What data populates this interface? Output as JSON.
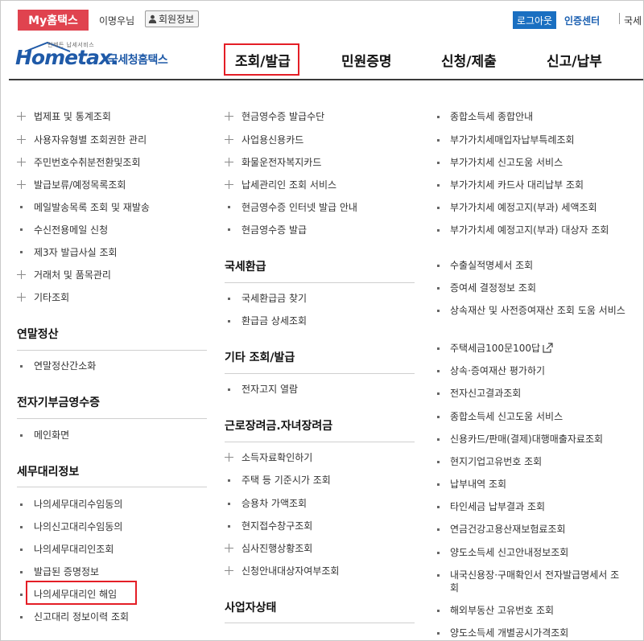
{
  "topbar": {
    "my_hometax": "My홈택스",
    "username": "이명우님",
    "member_info": "회원정보",
    "logout": "로그아웃",
    "cert_center": "인증센터",
    "more": "국세"
  },
  "header": {
    "logo_small": "언제든 납세서비스",
    "logo_main": "Hometax.",
    "logo_korean": "국세청홈택스",
    "nav": [
      "조회/발급",
      "민원증명",
      "신청/제출",
      "신고/납부"
    ],
    "active_nav": "조회/발급"
  },
  "col1": {
    "items": [
      {
        "text": "법제표 및 통계조회",
        "icon": "plus"
      },
      {
        "text": "사용자유형별 조회권한 관리",
        "icon": "plus"
      },
      {
        "text": "주민번호수취분전환및조회",
        "icon": "plus"
      },
      {
        "text": "발급보류/예정목록조회",
        "icon": "plus"
      },
      {
        "text": "메일발송목록 조회 및 재발송",
        "icon": "dot"
      },
      {
        "text": "수신전용메일 신청",
        "icon": "dot"
      },
      {
        "text": "제3자 발급사실 조회",
        "icon": "dot"
      },
      {
        "text": "거래처 및 품목관리",
        "icon": "plus"
      },
      {
        "text": "기타조회",
        "icon": "plus"
      }
    ],
    "sections": [
      {
        "title": "연말정산",
        "items": [
          "연말정산간소화"
        ]
      },
      {
        "title": "전자기부금영수증",
        "items": [
          "메인화면"
        ]
      },
      {
        "title": "세무대리정보",
        "items": [
          "나의세무대리수임동의",
          "나의신고대리수임동의",
          "나의세무대리인조회",
          "발급된 증명정보",
          "나의세무대리인 해임",
          "신고대리 정보이력 조회"
        ]
      }
    ]
  },
  "col2": {
    "items": [
      {
        "text": "현금영수증 발급수단",
        "icon": "plus"
      },
      {
        "text": "사업용신용카드",
        "icon": "plus"
      },
      {
        "text": "화물운전자복지카드",
        "icon": "plus"
      },
      {
        "text": "납세관리인 조회 서비스",
        "icon": "plus"
      },
      {
        "text": "현금영수증 인터넷 발급 안내",
        "icon": "dot"
      },
      {
        "text": "현금영수증 발급",
        "icon": "dot"
      }
    ],
    "sections": [
      {
        "title": "국세환급",
        "items": [
          {
            "text": "국세환급금 찾기",
            "icon": "dot"
          },
          {
            "text": "환급금 상세조회",
            "icon": "dot"
          }
        ]
      },
      {
        "title": "기타 조회/발급",
        "items": [
          {
            "text": "전자고지 열람",
            "icon": "dot"
          }
        ]
      },
      {
        "title": "근로장려금.자녀장려금",
        "items": [
          {
            "text": "소득자료확인하기",
            "icon": "plus"
          },
          {
            "text": "주택 등 기준시가 조회",
            "icon": "dot"
          },
          {
            "text": "승용차 가액조회",
            "icon": "dot"
          },
          {
            "text": "현지접수창구조회",
            "icon": "dot"
          },
          {
            "text": "심사진행상황조회",
            "icon": "plus"
          },
          {
            "text": "신청안내대상자여부조회",
            "icon": "plus"
          }
        ]
      },
      {
        "title": "사업자상태",
        "items": []
      }
    ]
  },
  "col3": {
    "items": [
      "종합소득세 종합안내",
      "부가가치세매입자납부특례조회",
      "부가가치세 신고도움 서비스",
      "부가가치세 카드사 대리납부 조회",
      "부가가치세 예정고지(부과) 세액조회",
      "부가가치세 예정고지(부과) 대상자 조회",
      "수출실적명세서 조회",
      "증여세 결정정보 조회",
      "상속재산 및 사전증여재산 조회 도움 서비스",
      "주택세금100문100답",
      "상속·증여재산 평가하기",
      "전자신고결과조회",
      "종합소득세 신고도움 서비스",
      "신용카드/판매(결제)대행매출자료조회",
      "현지기업고유번호 조회",
      "납부내역 조회",
      "타인세금 납부결과 조회",
      "연금건강고용산재보험료조회",
      "양도소득세 신고안내정보조회",
      "내국신용장·구매확인서 전자발급명세서 조회",
      "해외부동산 고유번호 조회",
      "양도소득세 개별공시가격조회"
    ]
  }
}
